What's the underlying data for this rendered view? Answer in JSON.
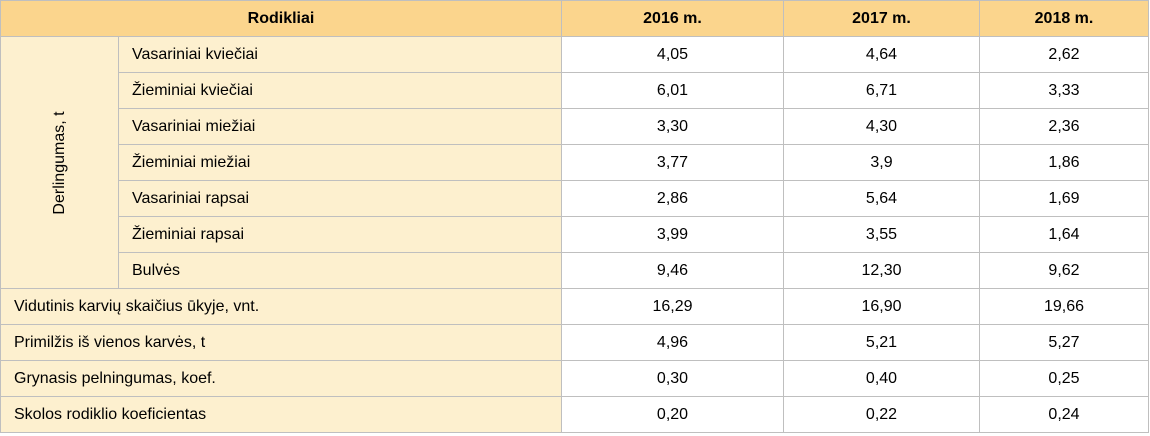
{
  "header": {
    "indicator_label": "Rodikliai",
    "years": [
      "2016 m.",
      "2017 m.",
      "2018 m."
    ]
  },
  "group": {
    "label": "Derlingumas, t",
    "rows": [
      {
        "label": "Vasariniai kviečiai",
        "values": [
          "4,05",
          "4,64",
          "2,62"
        ]
      },
      {
        "label": "Žieminiai kviečiai",
        "values": [
          "6,01",
          "6,71",
          "3,33"
        ]
      },
      {
        "label": "Vasariniai miežiai",
        "values": [
          "3,30",
          "4,30",
          "2,36"
        ]
      },
      {
        "label": "Žieminiai miežiai",
        "values": [
          "3,77",
          "3,9",
          "1,86"
        ]
      },
      {
        "label": "Vasariniai rapsai",
        "values": [
          "2,86",
          "5,64",
          "1,69"
        ]
      },
      {
        "label": "Žieminiai rapsai",
        "values": [
          "3,99",
          "3,55",
          "1,64"
        ]
      },
      {
        "label": "Bulvės",
        "values": [
          "9,46",
          "12,30",
          "9,62"
        ]
      }
    ]
  },
  "rows": [
    {
      "label": "Vidutinis karvių skaičius ūkyje, vnt.",
      "values": [
        "16,29",
        "16,90",
        "19,66"
      ]
    },
    {
      "label": "Primilžis iš vienos karvės, t",
      "values": [
        "4,96",
        "5,21",
        "5,27"
      ]
    },
    {
      "label": "Grynasis pelningumas, koef.",
      "values": [
        "0,30",
        "0,40",
        "0,25"
      ]
    },
    {
      "label": "Skolos rodiklio koeficientas",
      "values": [
        "0,20",
        "0,22",
        "0,24"
      ]
    }
  ],
  "colors": {
    "header_bg": "#fbd58d",
    "label_bg": "#fdf0cf",
    "border": "#bfbfbf"
  }
}
